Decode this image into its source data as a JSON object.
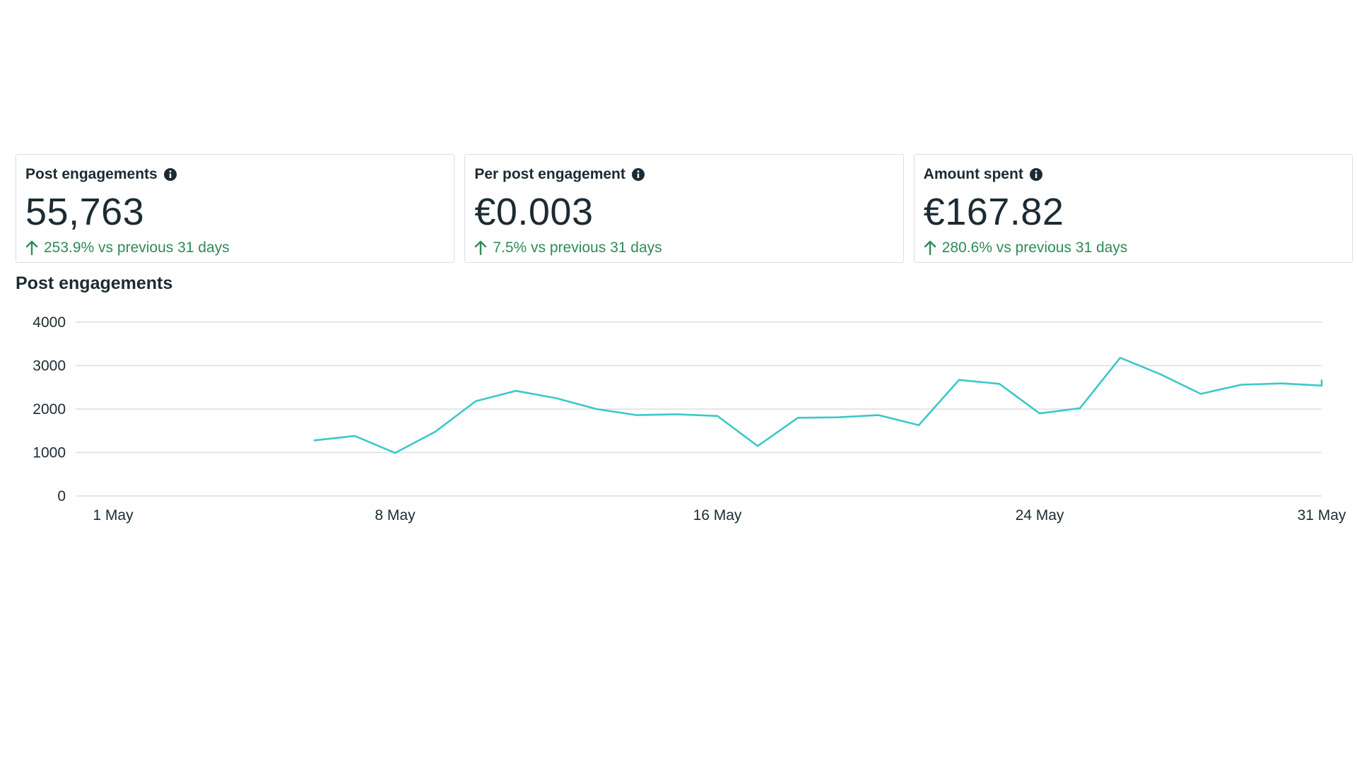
{
  "cards": [
    {
      "title": "Post engagements",
      "value": "55,763",
      "delta": "253.9% vs previous 31 days"
    },
    {
      "title": "Per post engagement",
      "value": "€0.003",
      "delta": "7.5% vs previous 31 days"
    },
    {
      "title": "Amount spent",
      "value": "€167.82",
      "delta": "280.6% vs previous 31 days"
    }
  ],
  "colors": {
    "line": "#3cc8c8",
    "positive": "#2e8b57",
    "grid": "#dadde1",
    "text": "#1c2b33"
  },
  "icons": {
    "info": "info-circle-icon",
    "delta": "arrow-up-icon"
  },
  "chart_data": {
    "type": "line",
    "title": "Post engagements",
    "x_labels": [
      "1 May",
      "8 May",
      "16 May",
      "24 May",
      "31 May"
    ],
    "x_label_days": [
      1,
      8,
      16,
      24,
      31
    ],
    "y_ticks": [
      0,
      1000,
      2000,
      3000,
      4000
    ],
    "ylim": [
      0,
      4000
    ],
    "xlim": [
      1,
      31
    ],
    "grid": true,
    "series": [
      {
        "points": [
          {
            "x": 6,
            "y": 1280
          },
          {
            "x": 7,
            "y": 1380
          },
          {
            "x": 8,
            "y": 990
          },
          {
            "x": 9,
            "y": 1480
          },
          {
            "x": 10,
            "y": 2180
          },
          {
            "x": 11,
            "y": 2420
          },
          {
            "x": 12,
            "y": 2250
          },
          {
            "x": 13,
            "y": 2000
          },
          {
            "x": 14,
            "y": 1860
          },
          {
            "x": 15,
            "y": 1880
          },
          {
            "x": 16,
            "y": 1840
          },
          {
            "x": 17,
            "y": 1150
          },
          {
            "x": 18,
            "y": 1800
          },
          {
            "x": 19,
            "y": 1810
          },
          {
            "x": 20,
            "y": 1860
          },
          {
            "x": 21,
            "y": 1630
          },
          {
            "x": 22,
            "y": 2670
          },
          {
            "x": 23,
            "y": 2580
          },
          {
            "x": 24,
            "y": 1900
          },
          {
            "x": 25,
            "y": 2020
          },
          {
            "x": 26,
            "y": 3180
          },
          {
            "x": 27,
            "y": 2800
          },
          {
            "x": 28,
            "y": 2350
          },
          {
            "x": 29,
            "y": 2560
          },
          {
            "x": 30,
            "y": 2590
          },
          {
            "x": 31,
            "y": 2540
          },
          {
            "x": 32,
            "y": 2660
          }
        ]
      }
    ]
  }
}
